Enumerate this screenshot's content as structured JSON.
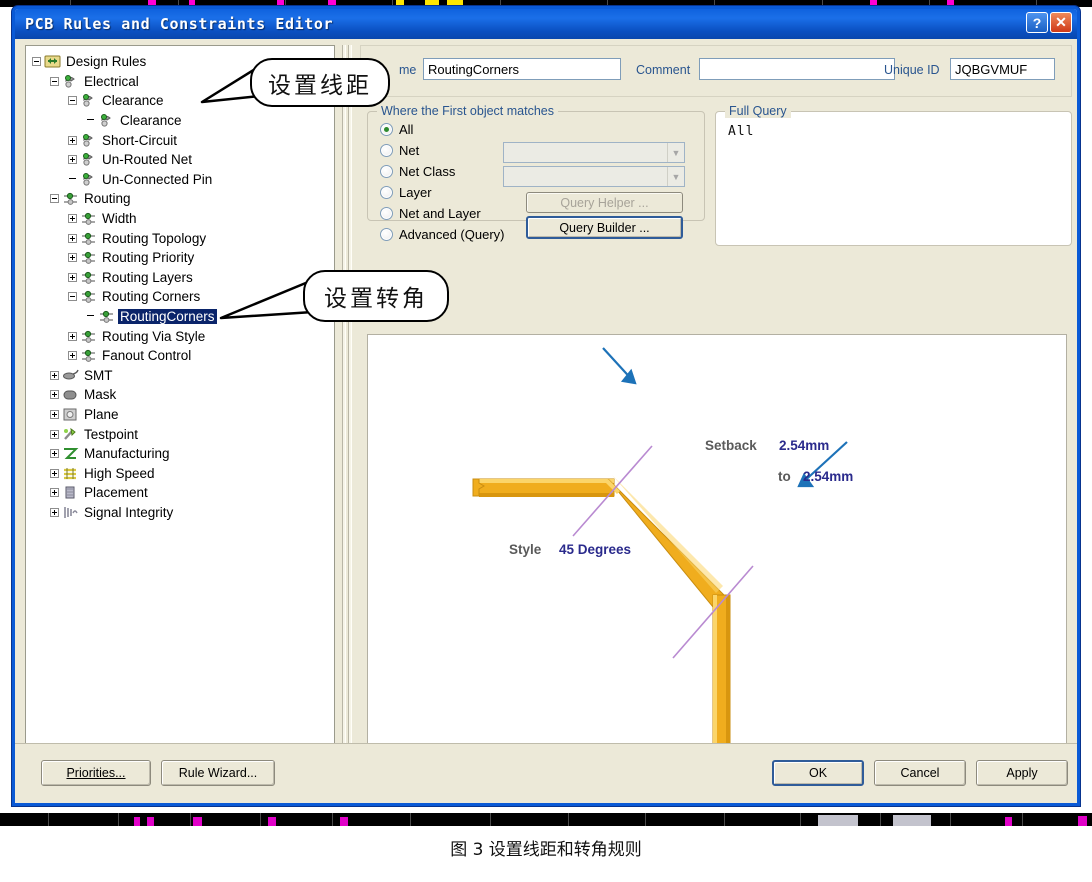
{
  "window": {
    "title": "PCB Rules and Constraints Editor",
    "help_button": "?",
    "close_button": "✕"
  },
  "tree": {
    "items": [
      {
        "label": "Design Rules",
        "depth": 0,
        "expander": "minus",
        "icon": "design-rules-icon",
        "selected": false
      },
      {
        "label": "Electrical",
        "depth": 1,
        "expander": "minus",
        "icon": "electrical-icon",
        "selected": false
      },
      {
        "label": "Clearance",
        "depth": 2,
        "expander": "minus",
        "icon": "clearance-icon",
        "selected": false
      },
      {
        "label": "Clearance",
        "depth": 3,
        "expander": "none",
        "icon": "clearance-icon",
        "selected": false
      },
      {
        "label": "Short-Circuit",
        "depth": 2,
        "expander": "plus",
        "icon": "short-circuit-icon",
        "selected": false
      },
      {
        "label": "Un-Routed Net",
        "depth": 2,
        "expander": "plus",
        "icon": "un-routed-net-icon",
        "selected": false
      },
      {
        "label": "Un-Connected Pin",
        "depth": 2,
        "expander": "none",
        "icon": "un-connected-pin-icon",
        "selected": false
      },
      {
        "label": "Routing",
        "depth": 1,
        "expander": "minus",
        "icon": "routing-icon",
        "selected": false
      },
      {
        "label": "Width",
        "depth": 2,
        "expander": "plus",
        "icon": "width-icon",
        "selected": false
      },
      {
        "label": "Routing Topology",
        "depth": 2,
        "expander": "plus",
        "icon": "routing-topology-icon",
        "selected": false
      },
      {
        "label": "Routing Priority",
        "depth": 2,
        "expander": "plus",
        "icon": "routing-priority-icon",
        "selected": false
      },
      {
        "label": "Routing Layers",
        "depth": 2,
        "expander": "plus",
        "icon": "routing-layers-icon",
        "selected": false
      },
      {
        "label": "Routing Corners",
        "depth": 2,
        "expander": "minus",
        "icon": "routing-corners-icon",
        "selected": false
      },
      {
        "label": "RoutingCorners",
        "depth": 3,
        "expander": "none",
        "icon": "routing-corners-icon",
        "selected": true
      },
      {
        "label": "Routing Via Style",
        "depth": 2,
        "expander": "plus",
        "icon": "routing-via-style-icon",
        "selected": false
      },
      {
        "label": "Fanout Control",
        "depth": 2,
        "expander": "plus",
        "icon": "fanout-control-icon",
        "selected": false
      },
      {
        "label": "SMT",
        "depth": 1,
        "expander": "plus",
        "icon": "smt-icon",
        "selected": false
      },
      {
        "label": "Mask",
        "depth": 1,
        "expander": "plus",
        "icon": "mask-icon",
        "selected": false
      },
      {
        "label": "Plane",
        "depth": 1,
        "expander": "plus",
        "icon": "plane-icon",
        "selected": false
      },
      {
        "label": "Testpoint",
        "depth": 1,
        "expander": "plus",
        "icon": "testpoint-icon",
        "selected": false
      },
      {
        "label": "Manufacturing",
        "depth": 1,
        "expander": "plus",
        "icon": "manufacturing-icon",
        "selected": false
      },
      {
        "label": "High Speed",
        "depth": 1,
        "expander": "plus",
        "icon": "high-speed-icon",
        "selected": false
      },
      {
        "label": "Placement",
        "depth": 1,
        "expander": "plus",
        "icon": "placement-icon",
        "selected": false
      },
      {
        "label": "Signal Integrity",
        "depth": 1,
        "expander": "plus",
        "icon": "signal-integrity-icon",
        "selected": false
      }
    ]
  },
  "form": {
    "name_label": "me",
    "name_value": "RoutingCorners",
    "comment_label": "Comment",
    "comment_value": "",
    "unique_id_label": "Unique ID",
    "unique_id_value": "JQBGVMUF"
  },
  "first_object": {
    "group_title": "Where the First object matches",
    "options": [
      {
        "label": "All",
        "selected": true
      },
      {
        "label": "Net",
        "selected": false
      },
      {
        "label": "Net Class",
        "selected": false
      },
      {
        "label": "Layer",
        "selected": false
      },
      {
        "label": "Net and Layer",
        "selected": false
      },
      {
        "label": "Advanced (Query)",
        "selected": false
      }
    ],
    "net_combo_value": "",
    "net_class_combo_value": "",
    "query_helper_button": "Query Helper ...",
    "query_builder_button": "Query Builder ..."
  },
  "full_query": {
    "group_title": "Full Query",
    "text": "All"
  },
  "constraint_graphic": {
    "setback_label": "Setback",
    "setback_value": "2.54mm",
    "to_label": "to",
    "to_value": "2.54mm",
    "style_label": "Style",
    "style_value": "45 Degrees",
    "track_color": "#f0ad1e",
    "accent_color": "#1d72b8"
  },
  "buttons": {
    "priorities": "Priorities...",
    "rule_wizard": "Rule Wizard...",
    "ok": "OK",
    "cancel": "Cancel",
    "apply": "Apply"
  },
  "callouts": [
    {
      "text": "设置线距"
    },
    {
      "text": "设置转角"
    }
  ],
  "caption": "图 3 设置线距和转角规则"
}
